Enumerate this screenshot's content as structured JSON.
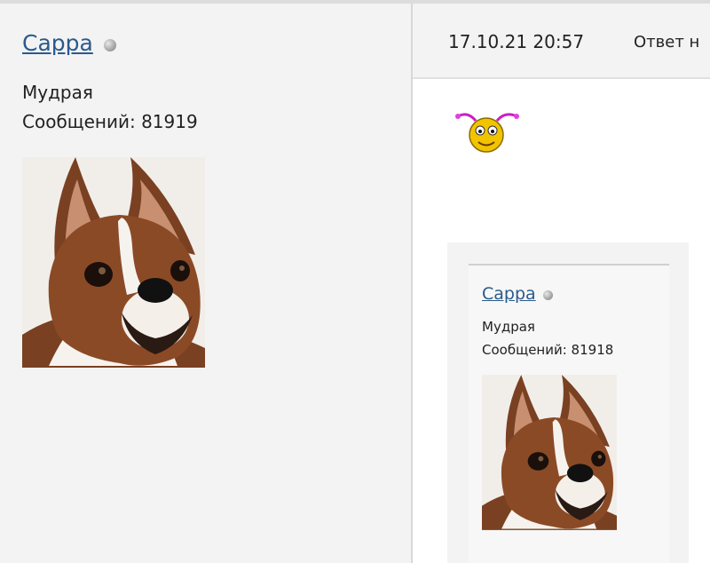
{
  "post": {
    "author": {
      "name": "Сарра",
      "rank": "Мудрая",
      "posts": "Сообщений: 81919",
      "avatar_icon": "boxer-dog-avatar",
      "status_icon": "offline-status-icon"
    },
    "header": {
      "date": "17.10.21 20:57",
      "action": "Ответ н"
    },
    "body": {
      "smiley_icon": "smiley-icon"
    },
    "quote": {
      "author": {
        "name": "Сарра",
        "rank": "Мудрая",
        "posts": "Сообщений: 81918",
        "avatar_icon": "boxer-dog-avatar",
        "status_icon": "offline-status-icon"
      }
    }
  },
  "colors": {
    "link": "#2a5a8c",
    "panel": "#f3f3f3",
    "border": "#d8d8d8"
  }
}
